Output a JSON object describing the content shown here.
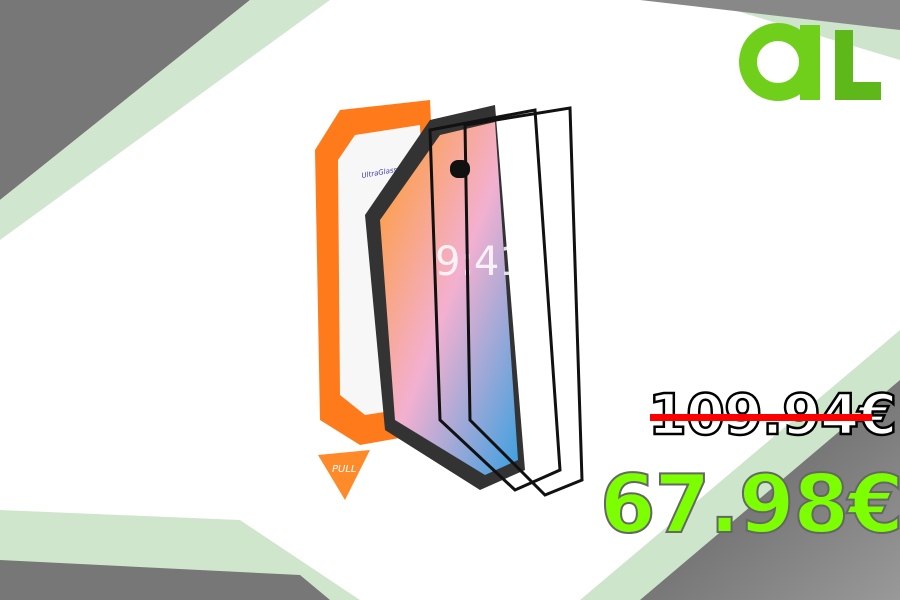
{
  "logo": {
    "text": "dL"
  },
  "product": {
    "brand_label": "UltraGlass",
    "tab_label": "PULL",
    "phone_time": "9:41"
  },
  "pricing": {
    "old_price": "109.94€",
    "new_price": "67.98€"
  },
  "colors": {
    "accent_green": "#7cff00",
    "strike_red": "#ff0000",
    "frame_orange": "#ff7a1a"
  }
}
